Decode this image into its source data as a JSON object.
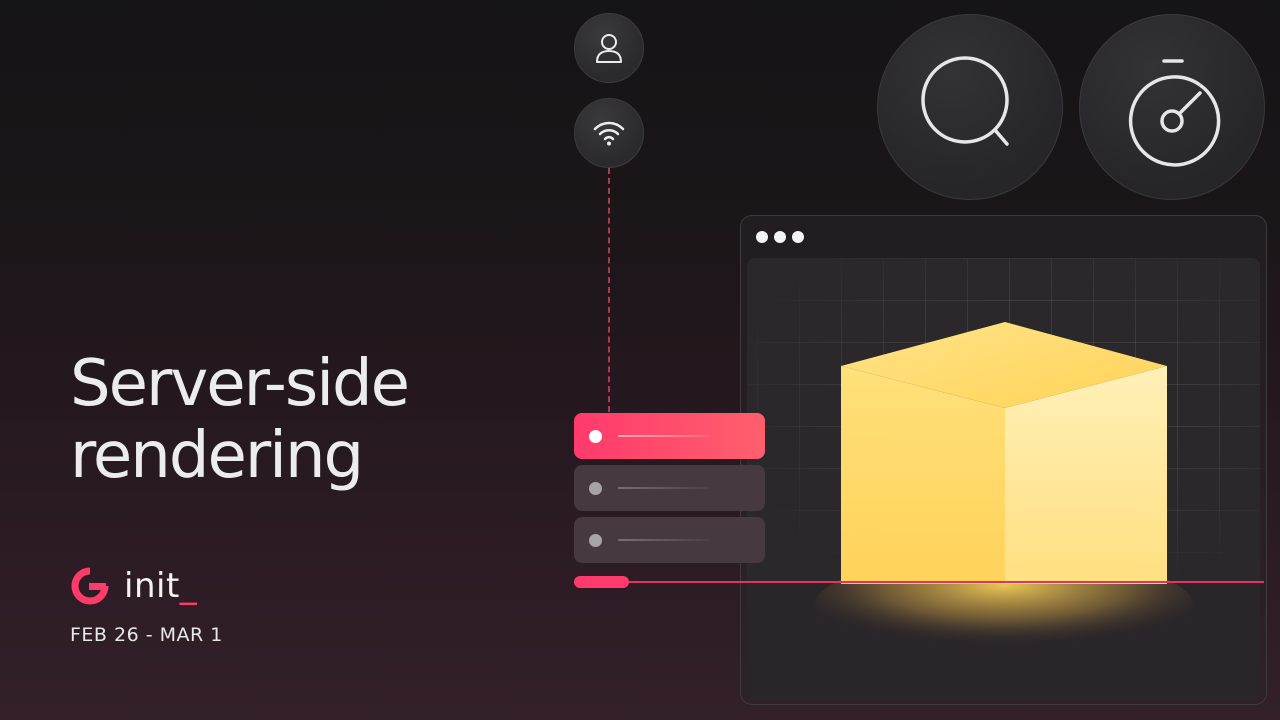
{
  "title": {
    "line1": "Server-side",
    "line2": "rendering"
  },
  "brand": {
    "name": "init",
    "underscore": "_",
    "accent_color": "#ff3b6b"
  },
  "event": {
    "dates": "FEB 26 - MAR 1"
  },
  "icons": {
    "small": [
      "user-icon",
      "wifi-icon"
    ],
    "large": [
      "search-icon",
      "stopwatch-icon"
    ]
  },
  "illustration": {
    "list_rows": [
      {
        "state": "active",
        "color": "#ff3a6c"
      },
      {
        "state": "inactive",
        "color": "#463a40"
      },
      {
        "state": "inactive",
        "color": "#463a40"
      }
    ],
    "cube_color": "#ffd86a"
  }
}
